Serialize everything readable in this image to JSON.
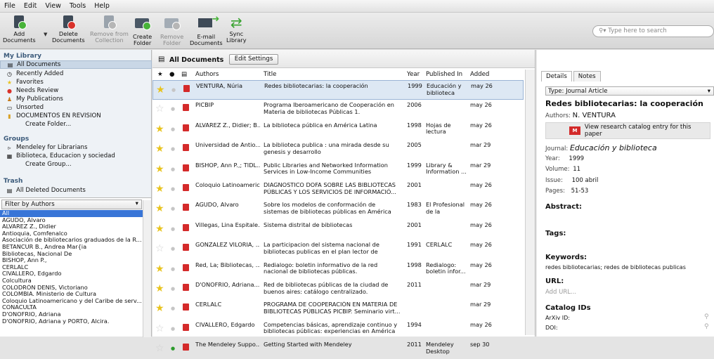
{
  "menu": [
    "File",
    "Edit",
    "View",
    "Tools",
    "Help"
  ],
  "toolbar": {
    "add": [
      "Add",
      "Documents"
    ],
    "delete": [
      "Delete",
      "Documents"
    ],
    "remove": [
      "Remove from",
      "Collection"
    ],
    "create": [
      "Create",
      "Folder"
    ],
    "remove_folder": [
      "Remove",
      "Folder"
    ],
    "email": [
      "E-mail",
      "Documents"
    ],
    "sync": [
      "Sync",
      "Library"
    ],
    "search_placeholder": "Type here to search"
  },
  "library": {
    "my_library": "My Library",
    "items": [
      "All Documents",
      "Recently Added",
      "Favorites",
      "Needs Review",
      "My Publications",
      "Unsorted",
      "DOCUMENTOS EN REVISION",
      "Create Folder..."
    ],
    "groups": "Groups",
    "group_items": [
      "Mendeley for Librarians",
      "Biblioteca, Educacion y sociedad",
      "Create Group..."
    ],
    "trash": "Trash",
    "trash_items": [
      "All Deleted Documents"
    ]
  },
  "filter": {
    "label": "Filter by Authors",
    "authors": [
      "All",
      "AGUDO, Alvaro",
      "ALVAREZ Z., Didier",
      "Antioquia, Comfenalco",
      "Asociación de bibliotecarios graduados de la R...",
      "BETANCUR B., Andrea Mar{ia",
      "Bibliotecas, Nacional De",
      "BISHOP, Ann P.,",
      "CERLALC",
      "CIVALLERO, Edgardo",
      "Colcultura",
      "COLODRÓN DENIS, Victoriano",
      "COLOMBIA. Ministerio de Cultura",
      "Coloquio Latinoamericano y del Caribe de serv...",
      "CONACULTA",
      "D'ONOFRIO, Adriana",
      "D'ONOFRIO, Adriana y PORTO, Alcira."
    ]
  },
  "center": {
    "title": "All Documents",
    "edit_settings": "Edit Settings",
    "columns": {
      "authors": "Authors",
      "title": "Title",
      "year": "Year",
      "published": "Published In",
      "added": "Added"
    },
    "rows": [
      {
        "star": true,
        "dot": false,
        "authors": "VENTURA, Núria",
        "title": "Redes bibliotecarias: la cooperación",
        "year": "1999",
        "pub": "Educación y biblioteca",
        "added": "may 26"
      },
      {
        "star": false,
        "dot": false,
        "authors": "PICBIP",
        "title": "Programa Iberoamericano de Cooperación en Materia de bibliotecas Públicas 1.",
        "year": "2006",
        "pub": "",
        "added": "may 26"
      },
      {
        "star": true,
        "dot": false,
        "authors": "ALVAREZ Z., Didier; B...",
        "title": "La biblioteca pública en América Latina",
        "year": "1998",
        "pub": "Hojas de lectura",
        "added": "may 26"
      },
      {
        "star": true,
        "dot": false,
        "authors": "Universidad de Antio...",
        "title": "La biblioteca publica : una mirada desde su genesis y desarrollo",
        "year": "2005",
        "pub": "",
        "added": "mar 29"
      },
      {
        "star": true,
        "dot": false,
        "authors": "BISHOP, Ann P.,; TIDL...",
        "title": "Public Libraries and Networked Information Services in Low-Income Communities",
        "year": "1999",
        "pub": "Library & Information ...",
        "added": "mar 29"
      },
      {
        "star": true,
        "dot": false,
        "authors": "Coloquio Latinoameric...",
        "title": "DIAGNOSTICO DOFA SOBRE LAS BIBLIOTECAS PÚBLICAS Y LOS SERVICIOS DE INFORMACIÓ...",
        "year": "2001",
        "pub": "",
        "added": "may 26"
      },
      {
        "star": true,
        "dot": false,
        "authors": "AGUDO, Alvaro",
        "title": "Sobre los modelos de conformación de sistemas de bibliotecas públicas en América Latina",
        "year": "1983",
        "pub": "El Profesional de la Informa...",
        "added": "may 26"
      },
      {
        "star": true,
        "dot": false,
        "authors": "Villegas, Lina Espitale...",
        "title": "Sistema distrital de bibliotecas",
        "year": "2001",
        "pub": "",
        "added": "may 26"
      },
      {
        "star": false,
        "dot": false,
        "authors": "GONZALEZ VILORIA, ...",
        "title": "La participacion del sistema nacional de bibliotecas publicas en el plan lector de venezu...",
        "year": "1991",
        "pub": "CERLALC",
        "added": "may 26"
      },
      {
        "star": true,
        "dot": false,
        "authors": "Red, La; Bibliotecas, ...",
        "title": "Redialogo: boletin informativo de la red nacional de bibliotecas públicas.",
        "year": "1998",
        "pub": "Redialogo: boletin infor...",
        "added": "may 26"
      },
      {
        "star": true,
        "dot": false,
        "authors": "D'ONOFRIO, Adriana...",
        "title": "Red de bibliotecas públicas de la ciudad de buenos aires: catálogo centralizado.",
        "year": "2011",
        "pub": "",
        "added": "mar 29"
      },
      {
        "star": true,
        "dot": false,
        "authors": "CERLALC",
        "title": "PROGRAMA DE COOPERACIÓN EN MATERIA DE BIBLIOTECAS PÚBLICAS PICBIP. Seminario virt...",
        "year": "",
        "pub": "",
        "added": "mar 29"
      },
      {
        "star": false,
        "dot": false,
        "authors": "CIVALLERO, Edgardo",
        "title": "Competencias básicas, aprendizaje continuo y bibliotecas públicas: experiencias en América L...",
        "year": "1994",
        "pub": "",
        "added": "may 26"
      },
      {
        "star": false,
        "dot": true,
        "authors": "The Mendeley Suppo...",
        "title": "Getting Started with Mendeley",
        "year": "2011",
        "pub": "Mendeley Desktop",
        "added": "sep 30"
      }
    ]
  },
  "details": {
    "tab_details": "Details",
    "tab_notes": "Notes",
    "type": "Type: Journal Article",
    "title": "Redes bibliotecarias: la cooperación",
    "authors_label": "Authors:",
    "authors_value": "N. VENTURA",
    "catalog_button": "View research catalog entry for this paper",
    "journal_label": "Journal:",
    "journal": "Educación y biblioteca",
    "year_label": "Year:",
    "year": "1999",
    "volume_label": "Volume:",
    "volume": "11",
    "issue_label": "Issue:",
    "issue": "100 abril",
    "pages_label": "Pages:",
    "pages": "51-53",
    "abstract": "Abstract:",
    "tags": "Tags:",
    "keywords": "Keywords:",
    "keywords_value": "redes bibliotecarias; redes de bibliotecas publicas",
    "url": "URL:",
    "url_placeholder": "Add URL...",
    "catalog_ids": "Catalog IDs",
    "arxiv": "ArXiv ID:",
    "doi": "DOI:"
  }
}
